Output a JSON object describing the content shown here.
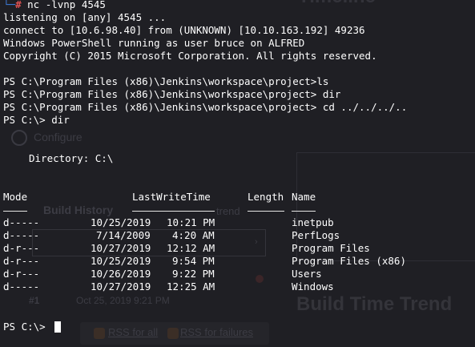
{
  "background": {
    "timeline_title": "Timeline",
    "configure_label": "Configure",
    "build_history_label": "Build History",
    "trend_label": "trend",
    "build_number": "#1",
    "build_date": "Oct 25, 2019 9:21 PM",
    "build_time_trend": "Build Time Trend",
    "rss_all": "RSS for all",
    "rss_failures": "RSS for failures"
  },
  "terminal": {
    "first_command": "nc -lvnp 4545",
    "prompt_symbol": "#",
    "output_lines": [
      "listening on [any] 4545 ...",
      "connect to [10.6.98.40] from (UNKNOWN) [10.10.163.192] 49236",
      "Windows PowerShell running as user bruce on ALFRED",
      "Copyright (C) 2015 Microsoft Corporation. All rights reserved."
    ],
    "ps_lines": [
      "PS C:\\Program Files (x86)\\Jenkins\\workspace\\project>ls",
      "PS C:\\Program Files (x86)\\Jenkins\\workspace\\project> dir",
      "PS C:\\Program Files (x86)\\Jenkins\\workspace\\project> cd ../../../..",
      "PS C:\\> dir"
    ],
    "directory_line": "Directory: C:\\",
    "columns": {
      "mode": "Mode",
      "last_write_time": "LastWriteTime",
      "length": "Length",
      "name": "Name"
    },
    "rows": [
      {
        "mode": "d-----",
        "date": "10/25/2019",
        "time": "10:21 PM",
        "name": "inetpub"
      },
      {
        "mode": "d-----",
        "date": "7/14/2009",
        "time": "4:20 AM",
        "name": "PerfLogs"
      },
      {
        "mode": "d-r---",
        "date": "10/27/2019",
        "time": "12:12 AM",
        "name": "Program Files"
      },
      {
        "mode": "d-r---",
        "date": "10/25/2019",
        "time": "9:54 PM",
        "name": "Program Files (x86)"
      },
      {
        "mode": "d-r---",
        "date": "10/26/2019",
        "time": "9:22 PM",
        "name": "Users"
      },
      {
        "mode": "d-----",
        "date": "10/27/2019",
        "time": "12:25 AM",
        "name": "Windows"
      }
    ],
    "final_prompt": "PS C:\\>"
  },
  "colors": {
    "background": "#1f1f24",
    "text": "#ffffff",
    "prompt_blue": "#3d7cdb",
    "hash_red": "#e05252"
  }
}
